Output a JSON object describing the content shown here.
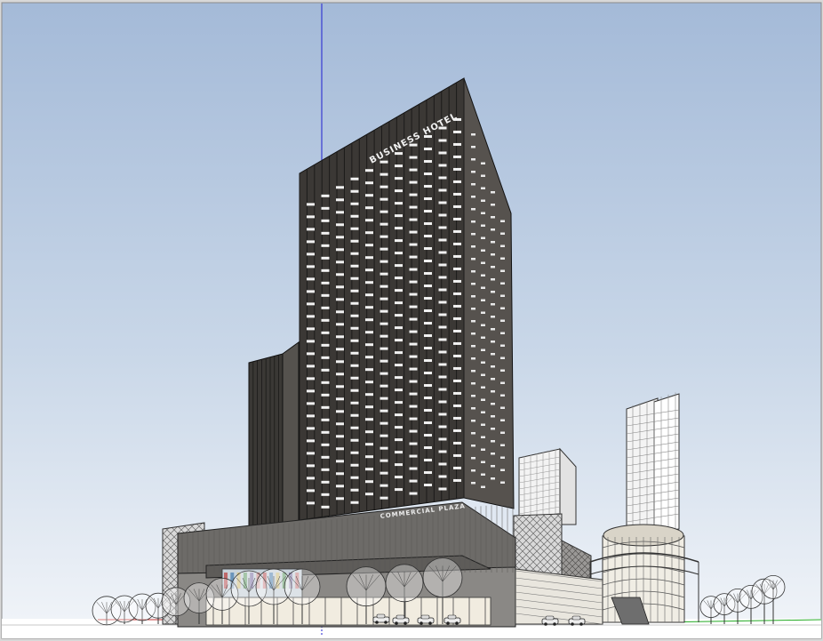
{
  "scene": {
    "type": "sketchup-viewport",
    "colors": {
      "sky_top": "#a6bcd9",
      "sky_bottom": "#eef3f8",
      "tower_dark": "#2c2a28",
      "tower_mid": "#4a4744",
      "podium": "#6c6a67",
      "ground": "#ffffff",
      "axis_blue": "#2222cc",
      "axis_green": "#22aa22"
    },
    "signs": {
      "tower_top": "BUSINESS HOTEL",
      "podium": "COMMERCIAL PLAZA"
    }
  }
}
